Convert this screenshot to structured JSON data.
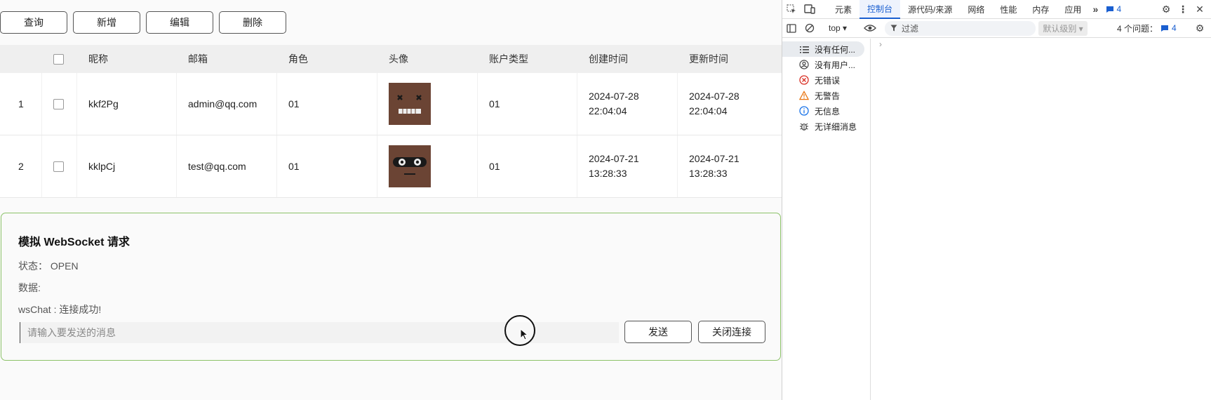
{
  "toolbar": {
    "query": "查询",
    "add": "新增",
    "edit": "编辑",
    "delete": "删除"
  },
  "table": {
    "headers": {
      "nickname": "昵称",
      "email": "邮箱",
      "role": "角色",
      "avatar": "头像",
      "account_type": "账户类型",
      "created": "创建时间",
      "updated": "更新时间"
    },
    "rows": [
      {
        "index": "1",
        "nickname": "kkf2Pg",
        "email": "admin@qq.com",
        "role": "01",
        "account_type": "01",
        "created_date": "2024-07-28",
        "created_time": "22:04:04",
        "updated_date": "2024-07-28",
        "updated_time": "22:04:04"
      },
      {
        "index": "2",
        "nickname": "kklpCj",
        "email": "test@qq.com",
        "role": "01",
        "account_type": "01",
        "created_date": "2024-07-21",
        "created_time": "13:28:33",
        "updated_date": "2024-07-21",
        "updated_time": "13:28:33"
      }
    ]
  },
  "ws": {
    "title": "模拟 WebSocket 请求",
    "status": "状态：  OPEN",
    "data_label": "数据:",
    "message": "wsChat : 连接成功!",
    "placeholder": "请输入要发送的消息",
    "send": "发送",
    "close": "关闭连接"
  },
  "devtools": {
    "tabs": [
      "元素",
      "控制台",
      "源代码/来源",
      "网络",
      "性能",
      "内存",
      "应用"
    ],
    "active_tab": "控制台",
    "issues_badge": "4",
    "context": "top ▾",
    "filter": "过滤",
    "level": "默认级别 ▾",
    "issues": "4 个问题：",
    "issues_count": "4",
    "sidebar": [
      "没有任何...",
      "没有用户...",
      "无错误",
      "无警告",
      "无信息",
      "无详细消息"
    ]
  },
  "colors": {
    "accent": "#1a5fd0",
    "card_border": "#8cc269",
    "avatar": "#6b4434",
    "error": "#d93025",
    "warning": "#e8710a",
    "info": "#1a73e8"
  }
}
